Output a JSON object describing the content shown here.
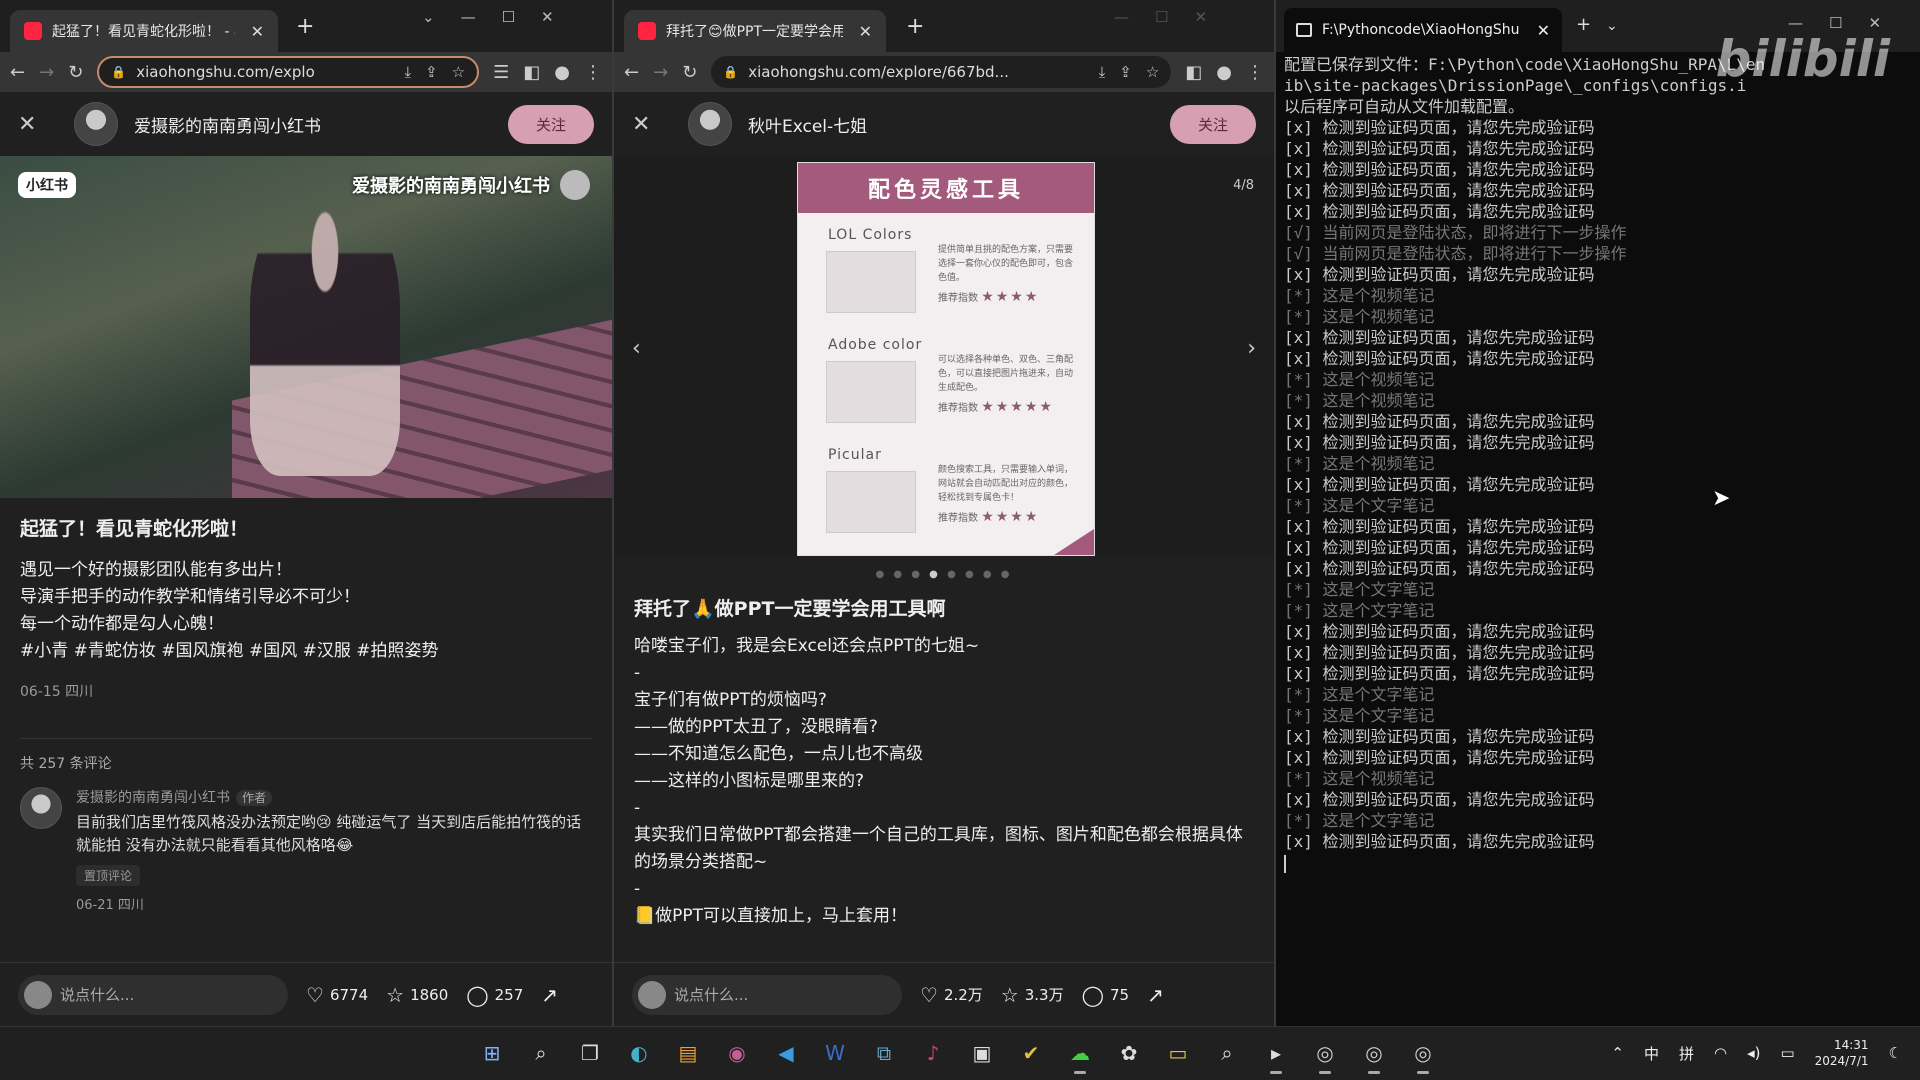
{
  "win1": {
    "tab_title": "起猛了！看见青蛇化形啦！ - 小",
    "url": "xiaohongshu.com/explo",
    "author": "爱摄影的南南勇闯小红书",
    "follow": "关注",
    "watermark": "小红书",
    "title": "起猛了！看见青蛇化形啦！",
    "lines": [
      "遇见一个好的摄影团队能有多出片！",
      "导演手把手的动作教学和情绪引导必不可少！",
      "每一个动作都是勾人心魄！"
    ],
    "tags": "#小青  #青蛇仿妆  #国风旗袍  #国风  #汉服  #拍照姿势",
    "date": "06-15 四川",
    "comment_count": "共 257 条评论",
    "comment": {
      "name": "爱摄影的南南勇闯小红书",
      "badge": "作者",
      "text": "目前我们店里竹筏风格没办法预定哟😢 纯碰运气了 当天到店后能拍竹筏的话就能拍 没有办法就只能看看其他风格咯😂",
      "pin": "置顶评论",
      "date": "06-21 四川"
    },
    "input_placeholder": "说点什么...",
    "likes": "6774",
    "stars": "1860",
    "comments": "257"
  },
  "win2": {
    "tab_title": "拜托了😊做PPT一定要学会用工",
    "url": "xiaohongshu.com/explore/667bd...",
    "author": "秋叶Excel-七姐",
    "follow": "关注",
    "pager": "4/8",
    "card_title": "配色灵感工具",
    "tools": [
      {
        "name": "LOL Colors",
        "desc": "提供简单且挑的配色方案，只需要选择一套你心仪的配色即可，包含色值。",
        "rating": "推荐指数"
      },
      {
        "name": "Adobe color",
        "desc": "可以选择各种单色、双色、三角配色，可以直接把图片拖进来，自动生成配色。",
        "rating": "推荐指数"
      },
      {
        "name": "Picular",
        "desc": "颜色搜索工具，只需要输入单词，网站就会自动匹配出对应的颜色，轻松找到专属色卡！",
        "rating": "推荐指数"
      }
    ],
    "title": "拜托了🙏做PPT一定要学会用工具啊",
    "lines": [
      "哈喽宝子们，我是会Excel还会点PPT的七姐~",
      "-",
      "宝子们有做PPT的烦恼吗?",
      "——做的PPT太丑了，没眼睛看?",
      "——不知道怎么配色，一点儿也不高级",
      "——这样的小图标是哪里来的?",
      "-",
      "其实我们日常做PPT都会搭建一个自己的工具库，图标、图片和配色都会根据具体的场景分类搭配~",
      "-",
      "📒做PPT可以直接加上，马上套用！"
    ],
    "input_placeholder": "说点什么...",
    "likes": "2.2万",
    "stars": "3.3万",
    "comments": "75"
  },
  "win3": {
    "tab_title": "F:\\Pythoncode\\XiaoHongShu",
    "watermark": "bilibili",
    "lines": [
      {
        "t": "配置已保存到文件：F:\\Python\\code\\XiaoHongShu_RPA\\L\\en",
        "dim": false
      },
      {
        "t": "ib\\site-packages\\DrissionPage\\_configs\\configs.i",
        "dim": false
      },
      {
        "t": "以后程序可自动从文件加载配置。",
        "dim": false
      },
      {
        "t": "[x] 检测到验证码页面，请您先完成验证码",
        "dim": false
      },
      {
        "t": "[x] 检测到验证码页面，请您先完成验证码",
        "dim": false
      },
      {
        "t": "[x] 检测到验证码页面，请您先完成验证码",
        "dim": false
      },
      {
        "t": "[x] 检测到验证码页面，请您先完成验证码",
        "dim": false
      },
      {
        "t": "[x] 检测到验证码页面，请您先完成验证码",
        "dim": false
      },
      {
        "t": "[√] 当前网页是登陆状态，即将进行下一步操作",
        "dim": true
      },
      {
        "t": "[√] 当前网页是登陆状态，即将进行下一步操作",
        "dim": true
      },
      {
        "t": "[x] 检测到验证码页面，请您先完成验证码",
        "dim": false
      },
      {
        "t": "[*] 这是个视频笔记",
        "dim": true
      },
      {
        "t": "[*] 这是个视频笔记",
        "dim": true
      },
      {
        "t": "[x] 检测到验证码页面，请您先完成验证码",
        "dim": false
      },
      {
        "t": "[x] 检测到验证码页面，请您先完成验证码",
        "dim": false
      },
      {
        "t": "[*] 这是个视频笔记",
        "dim": true
      },
      {
        "t": "[*] 这是个视频笔记",
        "dim": true
      },
      {
        "t": "[x] 检测到验证码页面，请您先完成验证码",
        "dim": false
      },
      {
        "t": "[x] 检测到验证码页面，请您先完成验证码",
        "dim": false
      },
      {
        "t": "[*] 这是个视频笔记",
        "dim": true
      },
      {
        "t": "[x] 检测到验证码页面，请您先完成验证码",
        "dim": false
      },
      {
        "t": "[*] 这是个文字笔记",
        "dim": true
      },
      {
        "t": "[x] 检测到验证码页面，请您先完成验证码",
        "dim": false
      },
      {
        "t": "[x] 检测到验证码页面，请您先完成验证码",
        "dim": false
      },
      {
        "t": "[x] 检测到验证码页面，请您先完成验证码",
        "dim": false
      },
      {
        "t": "[*] 这是个文字笔记",
        "dim": true
      },
      {
        "t": "[*] 这是个文字笔记",
        "dim": true
      },
      {
        "t": "[x] 检测到验证码页面，请您先完成验证码",
        "dim": false
      },
      {
        "t": "[x] 检测到验证码页面，请您先完成验证码",
        "dim": false
      },
      {
        "t": "[x] 检测到验证码页面，请您先完成验证码",
        "dim": false
      },
      {
        "t": "[*] 这是个文字笔记",
        "dim": true
      },
      {
        "t": "[*] 这是个文字笔记",
        "dim": true
      },
      {
        "t": "[x] 检测到验证码页面，请您先完成验证码",
        "dim": false
      },
      {
        "t": "[x] 检测到验证码页面，请您先完成验证码",
        "dim": false
      },
      {
        "t": "[*] 这是个视频笔记",
        "dim": true
      },
      {
        "t": "[x] 检测到验证码页面，请您先完成验证码",
        "dim": false
      },
      {
        "t": "[*] 这是个文字笔记",
        "dim": true
      },
      {
        "t": "[x] 检测到验证码页面，请您先完成验证码",
        "dim": false
      }
    ]
  },
  "taskbar": {
    "ime1": "中",
    "ime2": "拼",
    "time": "14:31",
    "date": "2024/7/1"
  }
}
